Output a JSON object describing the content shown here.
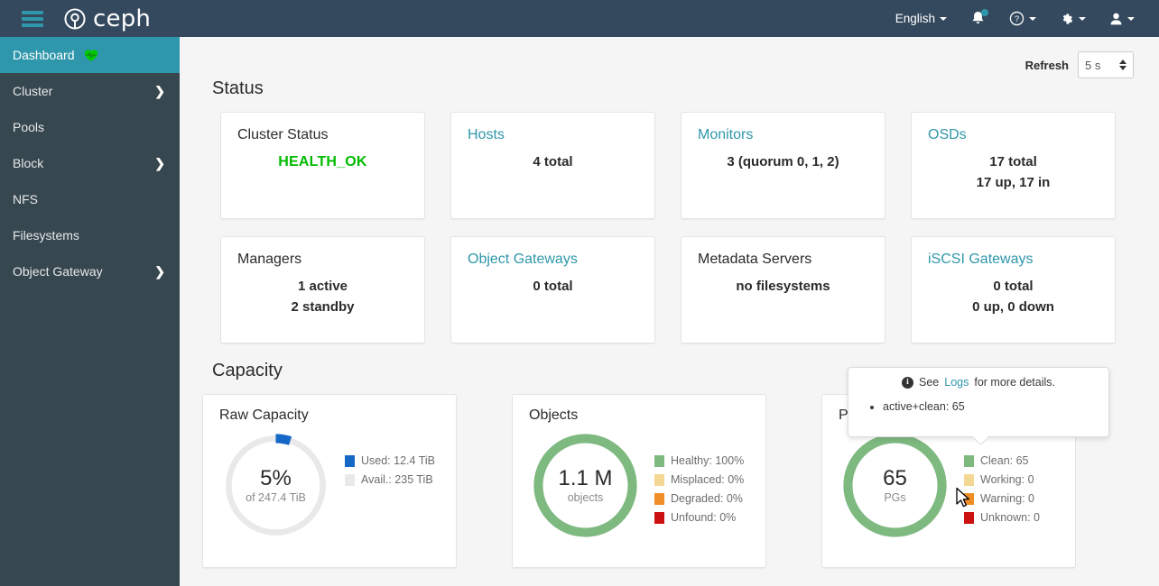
{
  "navbar": {
    "brand": "ceph",
    "menu_icon": "hamburger-icon",
    "language": "English",
    "icons": {
      "notifications": "bell-icon",
      "help": "question-circle-icon",
      "settings": "gear-icon",
      "user": "user-icon"
    }
  },
  "sidebar": {
    "items": [
      {
        "label": "Dashboard",
        "active": true,
        "icon": "heart-pulse-icon",
        "expandable": false
      },
      {
        "label": "Cluster",
        "active": false,
        "expandable": true
      },
      {
        "label": "Pools",
        "active": false,
        "expandable": false
      },
      {
        "label": "Block",
        "active": false,
        "expandable": true
      },
      {
        "label": "NFS",
        "active": false,
        "expandable": false
      },
      {
        "label": "Filesystems",
        "active": false,
        "expandable": false
      },
      {
        "label": "Object Gateway",
        "active": false,
        "expandable": true
      }
    ]
  },
  "toolbar": {
    "refresh_label": "Refresh",
    "refresh_value": "5 s"
  },
  "status": {
    "heading": "Status",
    "cards": [
      {
        "title": "Cluster Status",
        "is_link": false,
        "lines": [
          "HEALTH_OK"
        ],
        "state": "ok"
      },
      {
        "title": "Hosts",
        "is_link": true,
        "lines": [
          "4 total"
        ],
        "state": "plain"
      },
      {
        "title": "Monitors",
        "is_link": true,
        "lines": [
          "3 (quorum 0, 1, 2)"
        ],
        "state": "plain"
      },
      {
        "title": "OSDs",
        "is_link": true,
        "lines": [
          "17 total",
          "17 up, 17 in"
        ],
        "state": "plain"
      },
      {
        "title": "Managers",
        "is_link": false,
        "lines": [
          "1 active",
          "2 standby"
        ],
        "state": "plain"
      },
      {
        "title": "Object Gateways",
        "is_link": true,
        "lines": [
          "0 total"
        ],
        "state": "plain"
      },
      {
        "title": "Metadata Servers",
        "is_link": false,
        "lines": [
          "no filesystems"
        ],
        "state": "plain"
      },
      {
        "title": "iSCSI Gateways",
        "is_link": true,
        "lines": [
          "0 total",
          "0 up, 0 down"
        ],
        "state": "plain"
      }
    ]
  },
  "capacity": {
    "heading": "Capacity",
    "cards": [
      {
        "title": "Raw Capacity",
        "center_value": "5%",
        "center_sub": "of 247.4 TiB",
        "legend": [
          {
            "label": "Used: 12.4 TiB",
            "color": "#1668c7"
          },
          {
            "label": "Avail.: 235 TiB",
            "color": "#e9e9e9"
          }
        ]
      },
      {
        "title": "Objects",
        "center_value": "1.1 M",
        "center_sub": "objects",
        "legend": [
          {
            "label": "Healthy: 100%",
            "color": "#7eb980"
          },
          {
            "label": "Misplaced: 0%",
            "color": "#f4d793"
          },
          {
            "label": "Degraded: 0%",
            "color": "#ef8e26"
          },
          {
            "label": "Unfound: 0%",
            "color": "#cc1111"
          }
        ]
      },
      {
        "title": "PG Status",
        "center_value": "65",
        "center_sub": "PGs",
        "legend": [
          {
            "label": "Clean: 65",
            "color": "#7eb980"
          },
          {
            "label": "Working: 0",
            "color": "#f4d793"
          },
          {
            "label": "Warning: 0",
            "color": "#ef8e26"
          },
          {
            "label": "Unknown: 0",
            "color": "#cc1111"
          }
        ]
      }
    ]
  },
  "popover": {
    "lead": "See",
    "link": "Logs",
    "trail": "for more details.",
    "items": [
      "active+clean: 65"
    ]
  },
  "chart_data": [
    {
      "type": "pie",
      "title": "Raw Capacity",
      "categories": [
        "Used",
        "Avail."
      ],
      "values": [
        12.4,
        235
      ],
      "unit": "TiB",
      "total": 247.4,
      "used_percent": 5,
      "colors": [
        "#1668c7",
        "#e9e9e9"
      ],
      "center_label": "5%",
      "center_sublabel": "of 247.4 TiB",
      "legend_position": "right",
      "donut": true
    },
    {
      "type": "pie",
      "title": "Objects",
      "categories": [
        "Healthy",
        "Misplaced",
        "Degraded",
        "Unfound"
      ],
      "values": [
        100,
        0,
        0,
        0
      ],
      "unit": "%",
      "total_objects": "1.1 M",
      "colors": [
        "#7eb980",
        "#f4d793",
        "#ef8e26",
        "#cc1111"
      ],
      "center_label": "1.1 M",
      "center_sublabel": "objects",
      "legend_position": "right",
      "donut": true
    },
    {
      "type": "pie",
      "title": "PG Status",
      "categories": [
        "Clean",
        "Working",
        "Warning",
        "Unknown"
      ],
      "values": [
        65,
        0,
        0,
        0
      ],
      "unit": "PGs",
      "colors": [
        "#7eb980",
        "#f4d793",
        "#ef8e26",
        "#cc1111"
      ],
      "center_label": "65",
      "center_sublabel": "PGs",
      "legend_position": "right",
      "donut": true
    }
  ]
}
